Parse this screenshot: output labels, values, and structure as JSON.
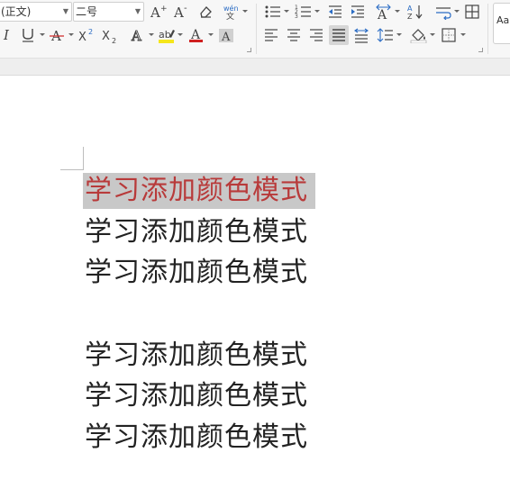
{
  "ribbon": {
    "font_name": "(正文)",
    "font_size": "二号",
    "style_preview": "Aa"
  },
  "document": {
    "lines": [
      "学习添加颜色模式",
      "学习添加颜色模式",
      "学习添加颜色模式",
      "",
      "学习添加颜色模式",
      "学习添加颜色模式",
      "学习添加颜色模式"
    ],
    "selected_line": 0,
    "selected_text_color": "#b83a3a",
    "selection_highlight_color": "#c8c8c8"
  }
}
